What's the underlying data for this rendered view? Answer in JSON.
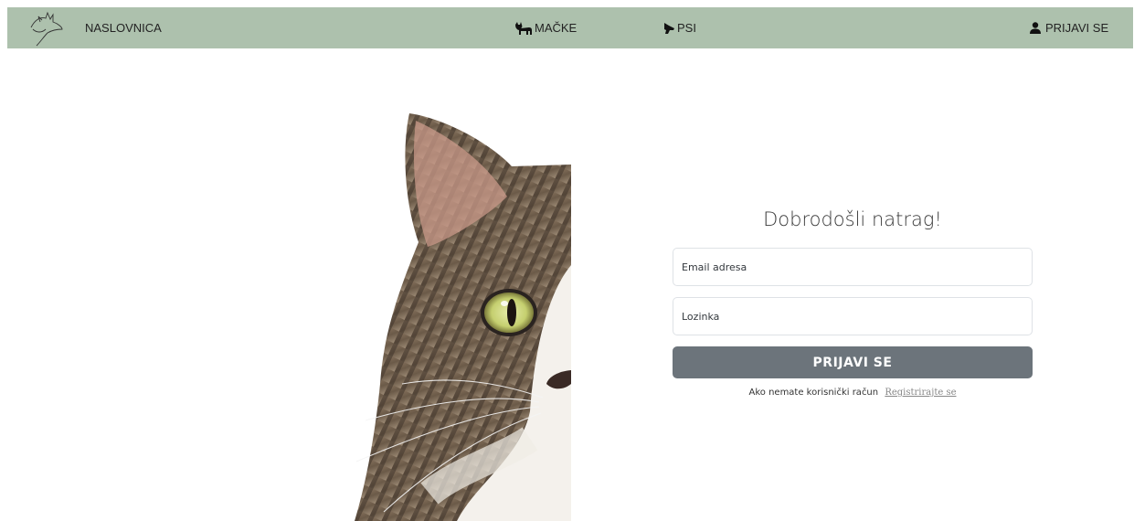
{
  "navbar": {
    "logo_icon": "cat-dog-line-logo-icon",
    "home_label": "NASLOVNICA",
    "cats_label": "MAČKE",
    "cats_icon": "cat-icon",
    "dogs_label": "PSI",
    "dogs_icon": "dog-icon",
    "login_label": "PRIJAVI SE",
    "login_icon": "user-icon",
    "background_color": "#adc1ad"
  },
  "hero_image": {
    "subject": "tabby cat face (left half)"
  },
  "login": {
    "title": "Dobrodošli natrag!",
    "email_placeholder": "Email adresa",
    "password_placeholder": "Lozinka",
    "submit_label": "PRIJAVI SE",
    "register_prompt": "Ako nemate korisnički račun",
    "register_link": "Registrirajte se",
    "button_color": "#6c747b"
  }
}
